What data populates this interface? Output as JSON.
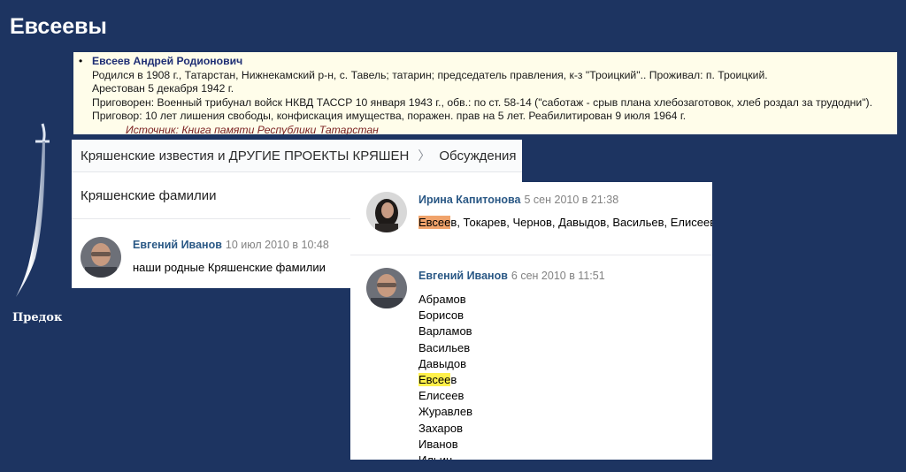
{
  "page": {
    "title": "Евсеевы"
  },
  "record": {
    "name": "Евсеев Андрей Родионович",
    "lines": [
      "Родился в 1908 г., Татарстан, Нижнекамский р-н, с. Тавель; татарин; председатель правления, к-з \"Троицкий\".. Проживал: п. Троицкий.",
      "Арестован 5 декабря 1942 г.",
      "Приговорен: Военный трибунал войск НКВД ТАССР 10 января 1943 г., обв.: по ст. 58-14 (\"саботаж - срыв плана хлебозаготовок, хлеб роздал за трудодни\").",
      "Приговор: 10 лет лишения свободы, конфискация имущества, поражен. прав на 5 лет. Реабилитирован 9 июля 1964 г."
    ],
    "source": "Источник: Книга памяти Республики Татарстан"
  },
  "sword": {
    "label": "Предок"
  },
  "forum": {
    "breadcrumb": {
      "group": "Кряшенские известия и ДРУГИЕ ПРОЕКТЫ КРЯШЕН",
      "section": "Обсуждения"
    },
    "topic_title": "Кряшенские фамилии",
    "posts": [
      {
        "author": "Евгений Иванов",
        "date": "10 июл 2010 в 10:48",
        "text": "наши родные Кряшенские фамилии"
      },
      {
        "author": "Ирина Капитонова",
        "date": "5 сен 2010 в 21:38",
        "text_highlight": "Евсее",
        "text_rest": "в, Токарев, Чернов, Давыдов, Васильев, Елисеев"
      },
      {
        "author": "Евгений Иванов",
        "date": "6 сен 2010 в 11:51",
        "list": [
          "Абрамов",
          "Борисов",
          "Варламов",
          "Васильев",
          "Давыдов",
          "Евсеев",
          "Елисеев",
          "Журавлев",
          "Захаров",
          "Иванов",
          "Ильин"
        ],
        "list_highlight": {
          "index": 5,
          "highlight": "Евсее",
          "rest": "в"
        }
      }
    ]
  },
  "colors": {
    "background": "#1d3461",
    "record_bg": "#fffdea",
    "link": "#2a5885",
    "highlight_orange": "#f0a36b",
    "highlight_yellow": "#fff04a"
  }
}
